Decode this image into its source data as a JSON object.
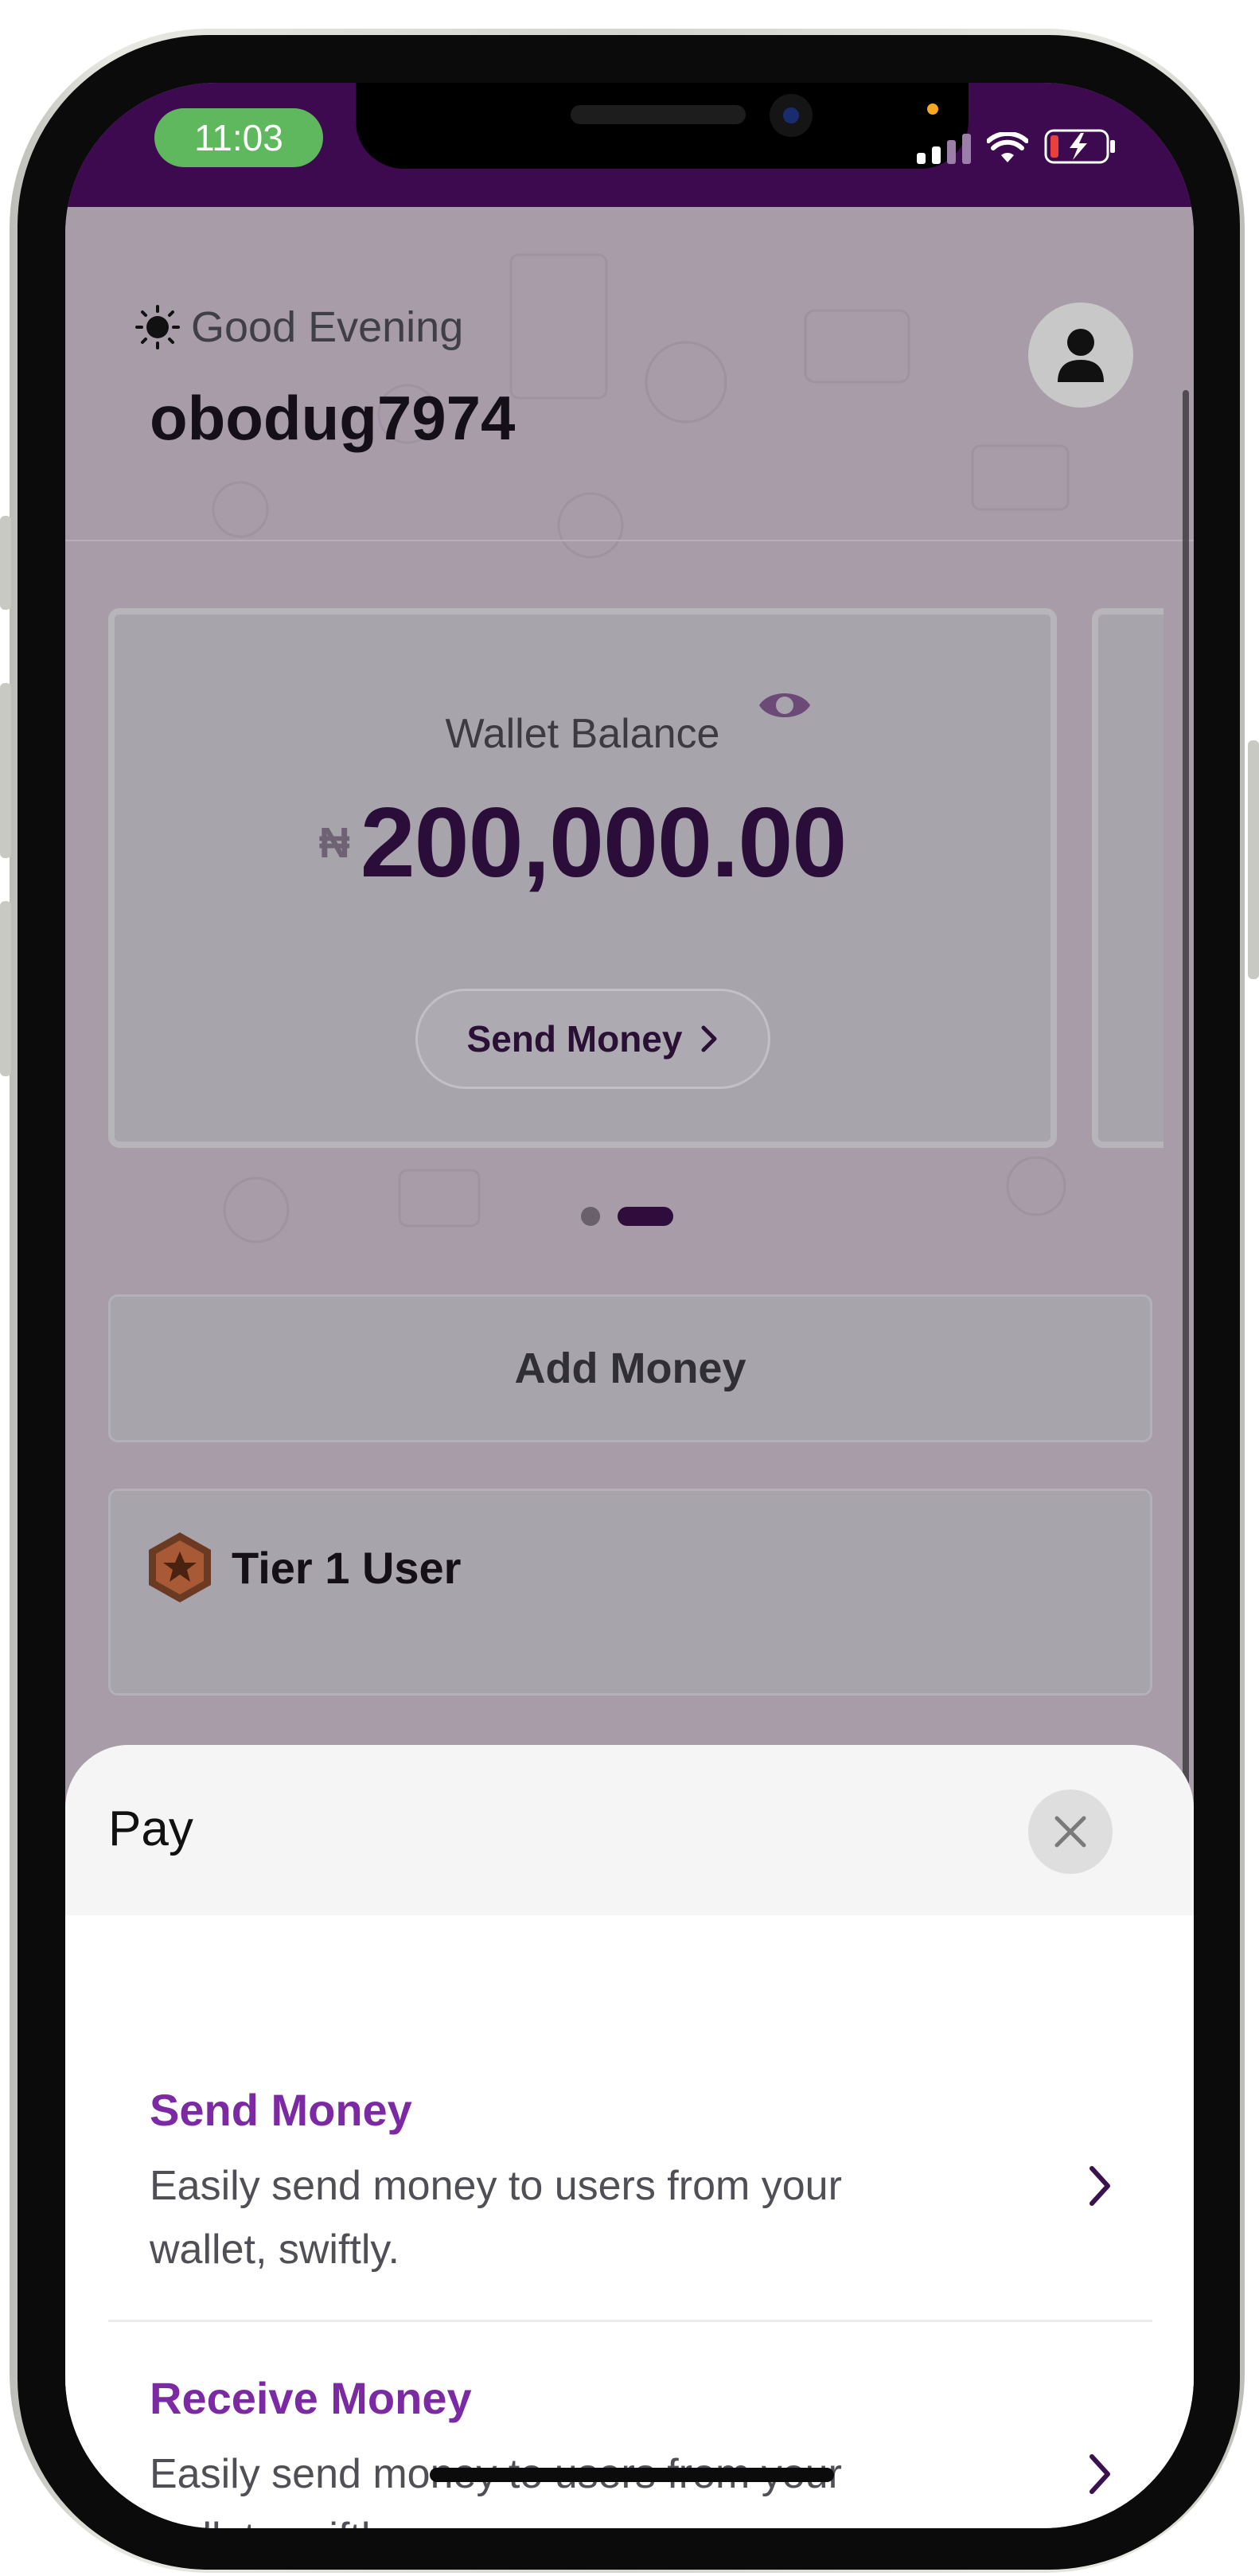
{
  "status_bar": {
    "time": "11:03"
  },
  "header": {
    "greeting": "Good Evening",
    "username": "obodug7974",
    "greeting_icon": "sun-icon",
    "avatar_icon": "user-icon"
  },
  "wallet": {
    "label": "Wallet Balance",
    "currency_symbol": "₦",
    "amount": "200,000.00",
    "send_button_label": "Send Money",
    "eye_icon": "eye-icon"
  },
  "carousel": {
    "page_count": 2,
    "active_index": 1
  },
  "actions": {
    "add_money_label": "Add Money"
  },
  "tier": {
    "label": "Tier 1 User",
    "badge_icon": "star-badge-icon"
  },
  "pay_sheet": {
    "title": "Pay",
    "options": [
      {
        "title": "Send Money",
        "description": "Easily send money to users from your wallet, swiftly."
      },
      {
        "title": "Receive Money",
        "description": "Easily send money to users from your wallet, swiftly."
      }
    ]
  },
  "colors": {
    "brand_purple": "#3d0a4f",
    "accent_purple": "#7b2aa3",
    "amount_color": "#2a0d39",
    "time_pill": "#5fb85d"
  }
}
